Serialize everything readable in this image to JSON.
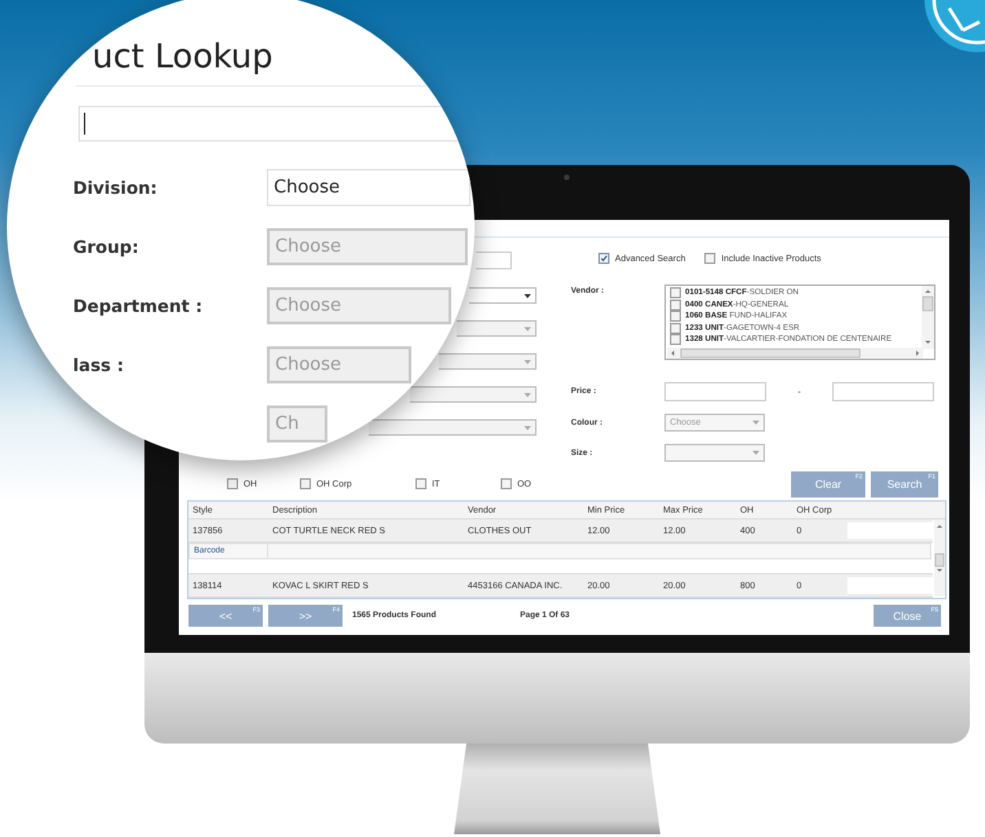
{
  "magnifier": {
    "title": "uct Lookup",
    "fields": [
      {
        "label": "Division:",
        "value": "Choose",
        "disabled": false
      },
      {
        "label": "Group:",
        "value": "Choose",
        "disabled": true
      },
      {
        "label": "Department :",
        "value": "Choose",
        "disabled": true
      },
      {
        "label": "lass :",
        "value": "Choose",
        "disabled": true
      },
      {
        "value": "Ch",
        "disabled": true
      }
    ]
  },
  "screen": {
    "options": [
      {
        "label": "Advanced Search",
        "checked": true
      },
      {
        "label": "Include Inactive Products",
        "checked": false
      }
    ],
    "dropdowns": [
      {
        "disabled": false
      },
      {
        "disabled": true
      },
      {
        "disabled": true
      },
      {
        "disabled": true
      },
      {
        "disabled": true
      }
    ],
    "vendor": {
      "label": "Vendor :",
      "items": [
        {
          "text": "**0101-5148 CFCF**-SOLDIER ON",
          "checked": false
        },
        {
          "text": "**0400 CANEX**-HQ-GENERAL",
          "checked": false
        },
        {
          "text": "**1060 BASE** FUND-HALIFAX",
          "checked": false
        },
        {
          "text": "**1233 UNIT**-GAGETOWN-4 ESR",
          "checked": false
        },
        {
          "text": "**1328 UNIT**-VALCARTIER-FONDATION DE CENTENAIRE",
          "checked": false
        }
      ]
    },
    "price": {
      "label": "Price :",
      "separator": "-"
    },
    "colour": {
      "label": "Colour :",
      "value": "Choose"
    },
    "size": {
      "label": "Size :"
    },
    "filters": [
      {
        "label": "OH",
        "checked": false
      },
      {
        "label": "OH Corp",
        "checked": false
      },
      {
        "label": "IT",
        "checked": false
      },
      {
        "label": "OO",
        "checked": false
      }
    ],
    "buttons": [
      {
        "label": "Clear",
        "key": "F2"
      },
      {
        "label": "Search",
        "key": "F1"
      }
    ],
    "table": {
      "columns": [
        "Style",
        "Description",
        "Vendor",
        "Min Price",
        "Max Price",
        "OH",
        "OH Corp"
      ],
      "rows": [
        {
          "kind": "product",
          "cells": [
            "137856",
            "COT TURTLE NECK RED S",
            "CLOTHES OUT",
            "12.00",
            "12.00",
            "400",
            "0"
          ]
        },
        {
          "kind": "detail",
          "label": "Barcode"
        },
        {
          "kind": "product",
          "cells": [
            "138114",
            "KOVAC L SKIRT RED S",
            "4453166 CANADA INC.",
            "20.00",
            "20.00",
            "800",
            "0"
          ]
        }
      ]
    },
    "footer": {
      "prev": {
        "label": "<<",
        "key": "F3"
      },
      "next": {
        "label": ">>",
        "key": "F4"
      },
      "count": "1565 Products Found",
      "page": "Page 1 Of 63",
      "close": {
        "label": "Close",
        "key": "F5"
      }
    }
  }
}
